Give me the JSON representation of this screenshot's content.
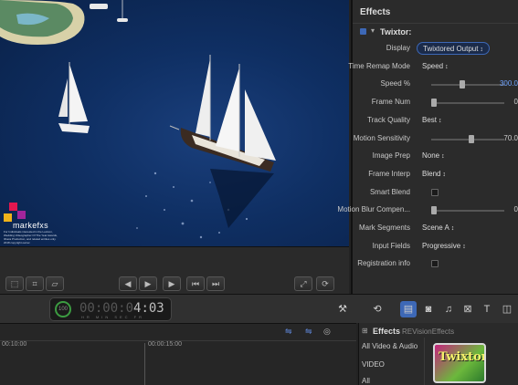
{
  "viewer": {
    "logo": {
      "brand": "markefxs",
      "fine_print": "For Individuals interested in the Lexicon, Wedding Videographer Of The Year Awards, Ithaca Production, and related entities only. 2018 copyright owner."
    }
  },
  "inspector": {
    "title": "Effects",
    "effect_name": "Twixtor:",
    "params": [
      {
        "label": "Display",
        "type": "popup",
        "value": "Twixtored Output",
        "active": true
      },
      {
        "label": "Time Remap Mode",
        "type": "popup",
        "value": "Speed"
      },
      {
        "label": "Speed %",
        "type": "slider",
        "level": 0.42,
        "value": "300.0",
        "highlight": true
      },
      {
        "label": "Frame Num",
        "type": "slider",
        "level": 0.0,
        "value": "0"
      },
      {
        "label": "Track Quality",
        "type": "popup",
        "value": "Best"
      },
      {
        "label": "Motion Sensitivity",
        "type": "slider",
        "level": 0.55,
        "value": "70.0"
      },
      {
        "label": "Image Prep",
        "type": "popup",
        "value": "None"
      },
      {
        "label": "Frame Interp",
        "type": "popup",
        "value": "Blend"
      },
      {
        "label": "Smart Blend",
        "type": "checkbox",
        "value": ""
      },
      {
        "label": "Motion Blur Compen...",
        "type": "slider",
        "level": 0.0,
        "value": "0"
      },
      {
        "label": "Mark Segments",
        "type": "popup",
        "value": "Scene A"
      },
      {
        "label": "Input Fields",
        "type": "popup",
        "value": "Progressive"
      },
      {
        "label": "Registration info",
        "type": "checkbox",
        "value": ""
      }
    ]
  },
  "timecode": {
    "ring_label": "100",
    "value": "4:03",
    "prefix": "00:00:0",
    "units": "HR MIN SEC FR"
  },
  "timeline": {
    "ruler": [
      "00:10:00",
      "00:00:15:00"
    ]
  },
  "browser": {
    "title": "Effects",
    "category_source": "REVisionEffects",
    "categories": [
      "All Video & Audio",
      "VIDEO",
      "All"
    ],
    "thumb_label": "Twixtor"
  },
  "colors": {
    "accent": "#3d68b6",
    "timecode_ring": "#3c9b41",
    "value_highlight": "#6fa4ff"
  }
}
